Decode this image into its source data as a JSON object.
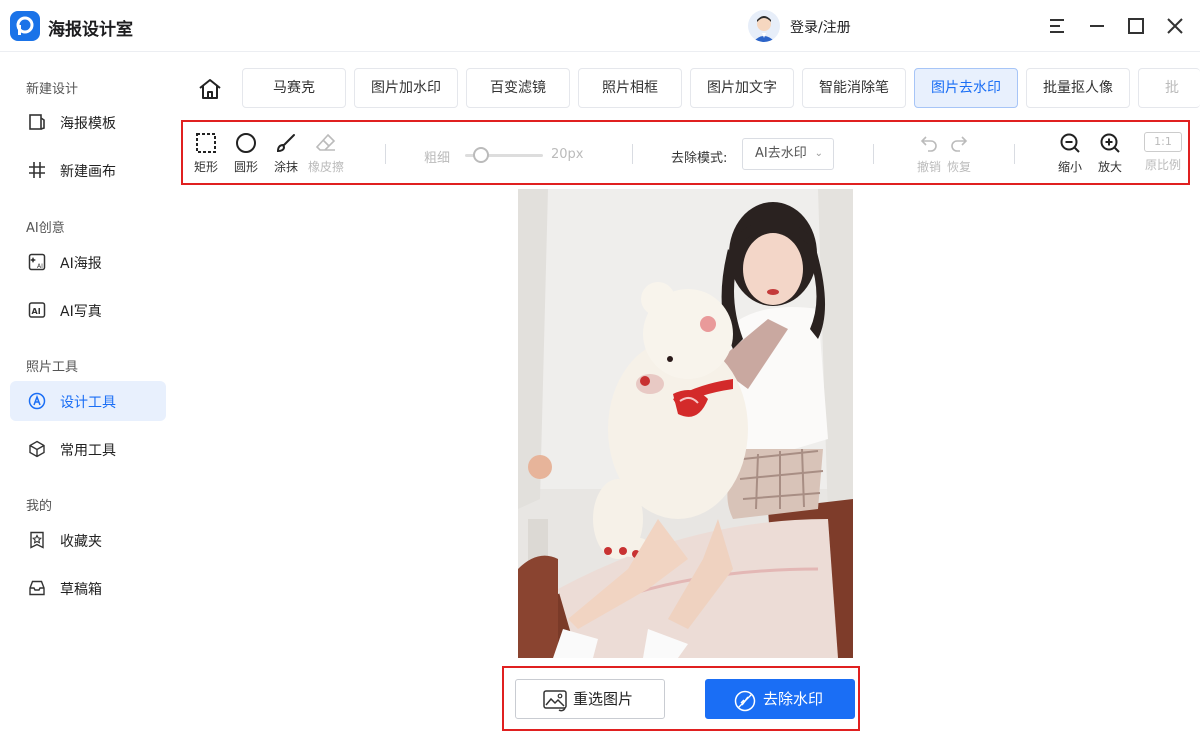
{
  "app": {
    "title": "海报设计室",
    "login": "登录/注册"
  },
  "sidebar": {
    "sections": [
      {
        "title": "新建设计",
        "items": [
          {
            "label": "海报模板",
            "icon": "poster-template-icon"
          },
          {
            "label": "新建画布",
            "icon": "new-canvas-icon"
          }
        ]
      },
      {
        "title": "AI创意",
        "items": [
          {
            "label": "AI海报",
            "icon": "ai-poster-icon"
          },
          {
            "label": "AI写真",
            "icon": "ai-portrait-icon"
          }
        ]
      },
      {
        "title": "照片工具",
        "items": [
          {
            "label": "设计工具",
            "icon": "design-tool-icon",
            "active": true
          },
          {
            "label": "常用工具",
            "icon": "common-tools-icon"
          }
        ]
      },
      {
        "title": "我的",
        "items": [
          {
            "label": "收藏夹",
            "icon": "favorites-icon"
          },
          {
            "label": "草稿箱",
            "icon": "drafts-icon"
          }
        ]
      }
    ]
  },
  "tabs": [
    "马赛克",
    "图片加水印",
    "百变滤镜",
    "照片相框",
    "图片加文字",
    "智能消除笔",
    "图片去水印",
    "批量抠人像",
    "批"
  ],
  "active_tab": "图片去水印",
  "toolbar": {
    "shapes": [
      "矩形",
      "圆形",
      "涂抹",
      "橡皮擦"
    ],
    "thickness_label": "粗细",
    "thickness_value": "20px",
    "thickness_level": 0.15,
    "mode_label": "去除模式:",
    "mode_value": "AI去水印",
    "undo": "撤销",
    "redo": "恢复",
    "zoom_out": "缩小",
    "zoom_in": "放大",
    "ratio_box": "1:1",
    "ratio_label": "原比例"
  },
  "actions": {
    "reselect": "重选图片",
    "remove": "去除水印"
  },
  "colors": {
    "accent": "#1a6ef5",
    "highlight_border": "#e02020",
    "disabled": "#bbbbbb"
  }
}
